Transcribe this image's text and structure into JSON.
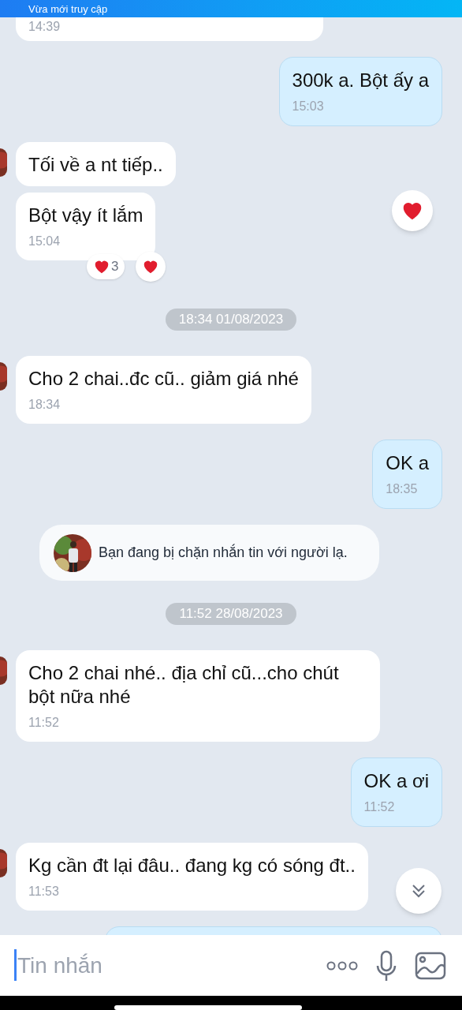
{
  "banner": {
    "text": "Vừa mới truy cập"
  },
  "messages": [
    {
      "kind": "incoming",
      "time": "14:39",
      "clipped": true
    },
    {
      "kind": "outgoing",
      "text": "300k a. Bột ấy a",
      "time": "15:03"
    },
    {
      "kind": "incoming",
      "text": "Tối về a nt tiếp..",
      "avatar": true
    },
    {
      "kind": "incoming",
      "text": "Bột vậy ít lắm",
      "time": "15:04",
      "react_button": true,
      "reactions": [
        {
          "kind": "summary",
          "count": "3"
        },
        {
          "kind": "mine"
        }
      ]
    },
    {
      "kind": "date",
      "text": "18:34 01/08/2023"
    },
    {
      "kind": "incoming",
      "text": "Cho 2 chai..đc cũ.. giảm giá nhé",
      "time": "18:34",
      "avatar": true
    },
    {
      "kind": "outgoing",
      "text": "OK a",
      "time": "18:35"
    },
    {
      "kind": "notice",
      "text": "Bạn đang bị chặn nhắn tin với người lạ."
    },
    {
      "kind": "date",
      "text": "11:52 28/08/2023"
    },
    {
      "kind": "incoming",
      "text": "Cho 2 chai nhé.. địa chỉ cũ...cho chút bột nữa nhé",
      "time": "11:52",
      "avatar": true
    },
    {
      "kind": "outgoing",
      "text": "OK a ơi",
      "time": "11:52"
    },
    {
      "kind": "incoming",
      "text": "Kg cần đt lại đâu.. đang kg có sóng đt..",
      "time": "11:53",
      "avatar": true
    },
    {
      "kind": "outgoing",
      "clipped": true
    }
  ],
  "composer": {
    "placeholder": "Tin nhắn"
  }
}
